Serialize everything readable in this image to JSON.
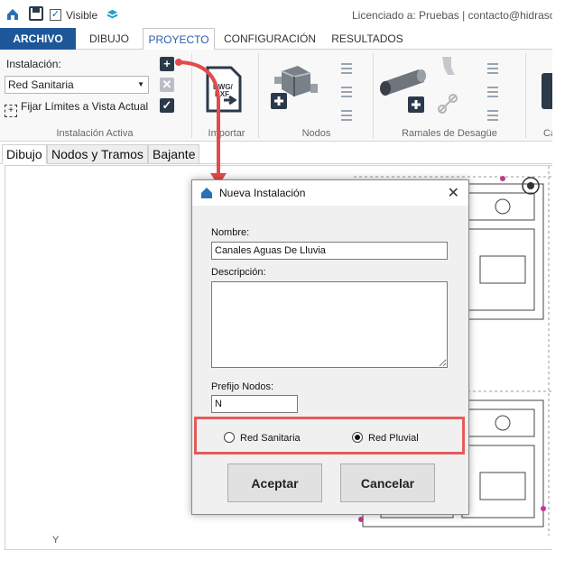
{
  "quick_access": {
    "visible_checked": true,
    "visible_label": "Visible",
    "license_text": "Licenciado a: Pruebas | contacto@hidrasoft"
  },
  "tabs": [
    {
      "label": "ARCHIVO"
    },
    {
      "label": "DIBUJO"
    },
    {
      "label": "PROYECTO",
      "active": true
    },
    {
      "label": "CONFIGURACIÓN"
    },
    {
      "label": "RESULTADOS"
    }
  ],
  "ribbon": {
    "instalacion_label": "Instalación:",
    "instalacion_value": "Red Sanitaria",
    "fijar_label": "Fijar Límites a Vista Actual",
    "groups": {
      "instalacion_activa": "Instalación Activa",
      "importar": "Importar",
      "nodos": "Nodos",
      "ramales": "Ramales de Desagüe",
      "cut": "Ca"
    },
    "dwg_text_1": "DWG/",
    "dwg_text_2": "DXF"
  },
  "subtabs": [
    {
      "label": "Dibujo",
      "active": true
    },
    {
      "label": "Nodos y Tramos"
    },
    {
      "label": "Bajante"
    }
  ],
  "canvas": {
    "axis_label": "Y"
  },
  "dialog": {
    "title": "Nueva Instalación",
    "nombre_label": "Nombre:",
    "nombre_value": "Canales Aguas De Lluvia",
    "descripcion_label": "Descripción:",
    "descripcion_value": "",
    "prefijo_label": "Prefijo Nodos:",
    "prefijo_value": "N",
    "radio_sanitaria": "Red Sanitaria",
    "radio_pluvial": "Red Pluvial",
    "selected": "Red Pluvial",
    "aceptar": "Aceptar",
    "cancelar": "Cancelar"
  },
  "colors": {
    "brand_blue": "#1e5799",
    "highlight_red": "#e34b4b",
    "add_icon": "#2b3a4a"
  }
}
